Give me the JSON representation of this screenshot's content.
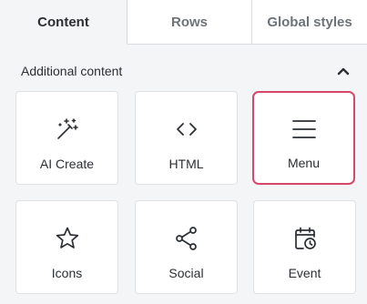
{
  "tabs": [
    {
      "label": "Content",
      "active": true
    },
    {
      "label": "Rows",
      "active": false
    },
    {
      "label": "Global styles",
      "active": false
    }
  ],
  "section": {
    "title": "Additional content",
    "collapse_icon": "chevron-up-icon"
  },
  "blocks": [
    {
      "label": "AI Create",
      "icon": "magic-wand-icon",
      "selected": false
    },
    {
      "label": "HTML",
      "icon": "code-brackets-icon",
      "selected": false
    },
    {
      "label": "Menu",
      "icon": "hamburger-menu-icon",
      "selected": true
    },
    {
      "label": "Icons",
      "icon": "star-icon",
      "selected": false
    },
    {
      "label": "Social",
      "icon": "share-icon",
      "selected": false
    },
    {
      "label": "Event",
      "icon": "calendar-clock-icon",
      "selected": false
    }
  ],
  "colors": {
    "selected_border": "#d6486a",
    "panel_background": "#f4f5f6",
    "card_background": "#ffffff"
  }
}
